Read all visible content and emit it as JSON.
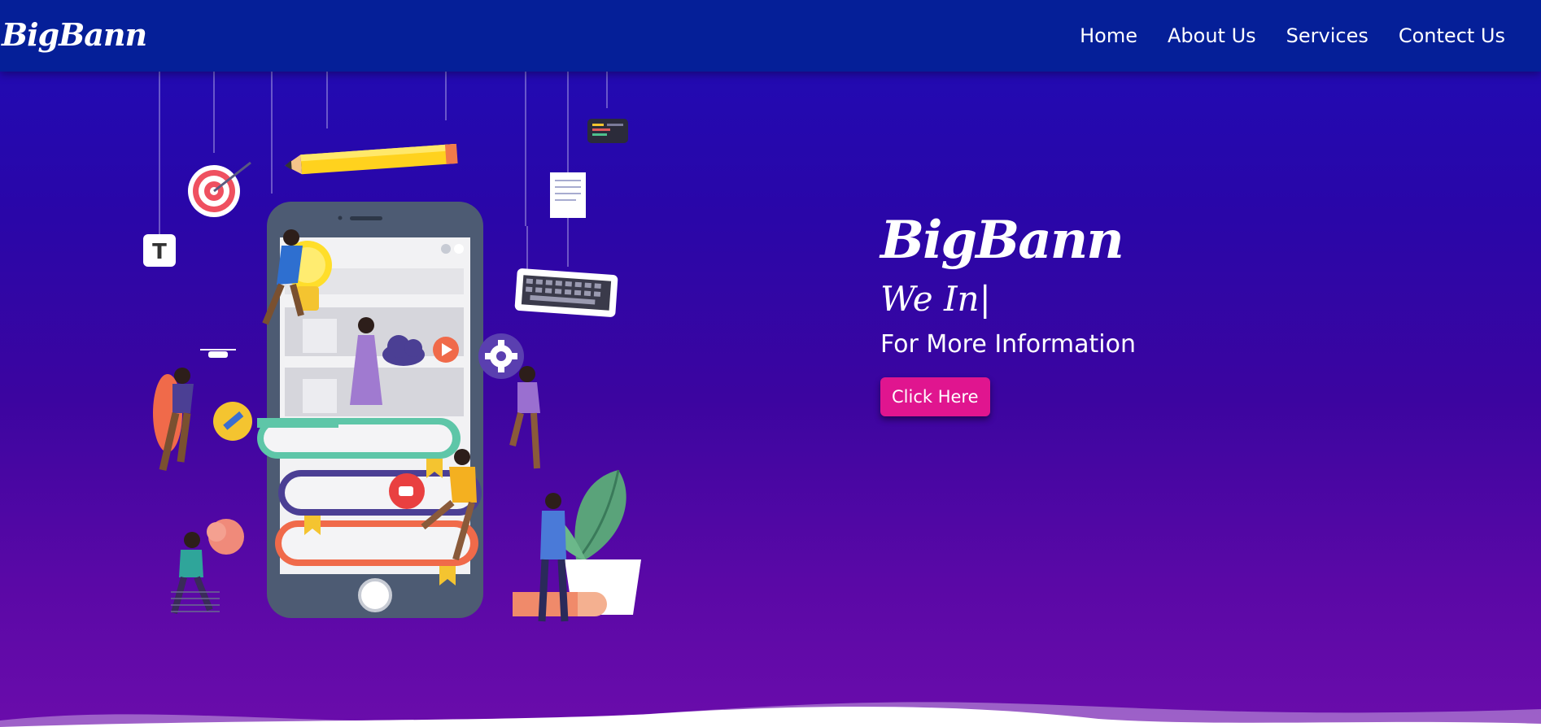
{
  "navbar": {
    "logo": "BigBann",
    "links": [
      "Home",
      "About Us",
      "Services",
      "Contect Us"
    ]
  },
  "hero": {
    "brand": "BigBann",
    "typed_text": "We In|",
    "info_text": "For More Information",
    "button_label": "Click Here",
    "illustration_alt": "",
    "illustration_tile_letter": "T"
  },
  "colors": {
    "navbar_bg": "#051f98",
    "hero_gradient_top": "#1e0cb6",
    "hero_gradient_bottom": "#6a0cab",
    "button_bg": "#e0158f",
    "text": "#ffffff"
  }
}
